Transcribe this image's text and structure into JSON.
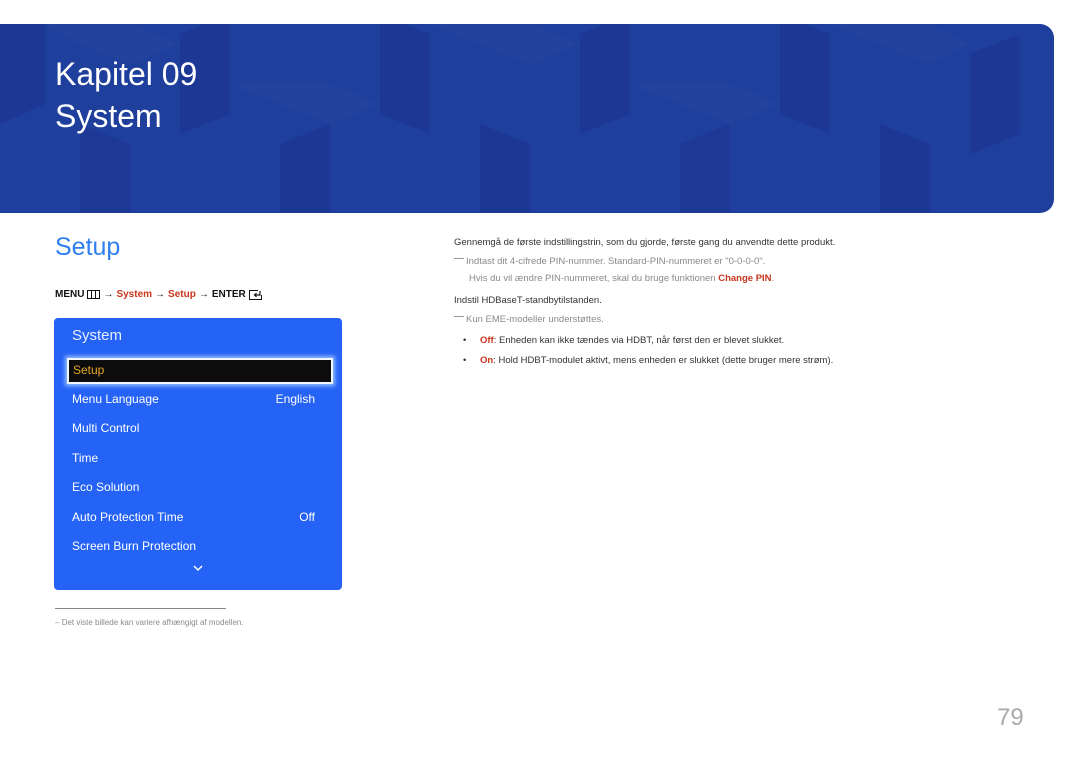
{
  "banner": {
    "chapter": "Kapitel 09",
    "title": "System",
    "color": "#1f3f9c"
  },
  "section": {
    "title": "Setup",
    "title_color": "#2f80ee"
  },
  "breadcrumb": {
    "menu_label": "MENU",
    "menu_icon": "menu-icon",
    "arrow": "→",
    "system": "System",
    "setup": "Setup",
    "enter_label": "ENTER",
    "enter_icon": "enter-icon",
    "accent_color": "#c8341c"
  },
  "osd_menu": {
    "title": "System",
    "selected_item": "Setup",
    "items": [
      {
        "label": "Menu Language",
        "value": "English"
      },
      {
        "label": "Multi Control",
        "value": ""
      },
      {
        "label": "Time",
        "value": ""
      },
      {
        "label": "Eco Solution",
        "value": ""
      },
      {
        "label": "Auto Protection Time",
        "value": "Off"
      },
      {
        "label": "Screen Burn Protection",
        "value": ""
      }
    ],
    "scroll_icon": "chevron-down-icon",
    "background_color": "#2563f6",
    "selected_text_color": "#e7a727"
  },
  "footnote": {
    "dash": "–",
    "text": "Det viste billede kan variere afhængigt af modellen."
  },
  "content": {
    "intro": "Gennemgå de første indstillingstrin, som du gjorde, første gang du anvendte dette produkt.",
    "note1_line1": "Indtast dit 4-cifrede PIN-nummer. Standard-PIN-nummeret er \"0-0-0-0\".",
    "note1_line2_prefix": "Hvis du vil ændre PIN-nummeret, skal du bruge funktionen ",
    "note1_line2_link": "Change PIN",
    "note1_line2_suffix": ".",
    "hdbt_heading": "Indstil HDBaseT-standbytilstanden.",
    "note2": "Kun EME-modeller understøttes.",
    "bullets": [
      {
        "key": "Off",
        "text": ": Enheden kan ikke tændes via HDBT, når først den er blevet slukket."
      },
      {
        "key": "On",
        "text": ": Hold HDBT-modulet aktivt, mens enheden er slukket (dette bruger mere strøm)."
      }
    ],
    "bullet_glyph": "•"
  },
  "page_number": "79"
}
